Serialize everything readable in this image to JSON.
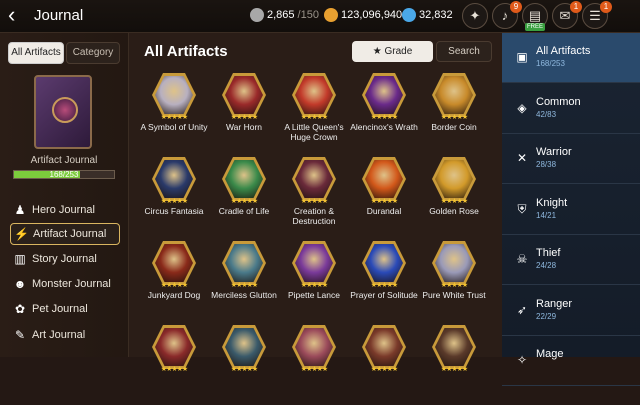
{
  "header": {
    "title": "Journal",
    "stamina": "2,865",
    "stamina_max": "/150",
    "gold": "123,096,940",
    "crystals": "32,832",
    "badges": {
      "bell": "9",
      "mail": "1",
      "grid": "1"
    },
    "free_label": "FREE",
    "icons": [
      "back-icon",
      "stamina-icon",
      "gold-icon",
      "crystal-icon",
      "event-icon",
      "bell-icon",
      "shop-icon",
      "mail-icon",
      "menu-icon"
    ]
  },
  "left": {
    "tabs": [
      "All Artifacts",
      "Category"
    ],
    "journal_label": "Artifact Journal",
    "progress_text": "168/253",
    "progress_fraction": 0.664,
    "nav": [
      {
        "label": "Hero Journal",
        "icon": "person-icon",
        "active": false
      },
      {
        "label": "Artifact Journal",
        "icon": "lightning-icon",
        "active": true
      },
      {
        "label": "Story Journal",
        "icon": "book-icon",
        "active": false
      },
      {
        "label": "Monster Journal",
        "icon": "monster-icon",
        "active": false
      },
      {
        "label": "Pet Journal",
        "icon": "paw-icon",
        "active": false
      },
      {
        "label": "Art Journal",
        "icon": "palette-icon",
        "active": false
      }
    ]
  },
  "center": {
    "title": "All Artifacts",
    "grade_label": "★ Grade",
    "search_label": "Search",
    "stars": "★★★★★",
    "artifacts": [
      {
        "name": "A Symbol of Unity",
        "color": "#b8b0c0"
      },
      {
        "name": "War Horn",
        "color": "#9a2a2a"
      },
      {
        "name": "A Little Queen's Huge Crown",
        "color": "#c23a2a"
      },
      {
        "name": "Alencinox's Wrath",
        "color": "#6a2a8a"
      },
      {
        "name": "Border Coin",
        "color": "#c88a2a"
      },
      {
        "name": "Circus Fantasia",
        "color": "#2a3a6a"
      },
      {
        "name": "Cradle of Life",
        "color": "#3a8a4a"
      },
      {
        "name": "Creation & Destruction",
        "color": "#6a2a3a"
      },
      {
        "name": "Durandal",
        "color": "#d2581a"
      },
      {
        "name": "Golden Rose",
        "color": "#d29a2a"
      },
      {
        "name": "Junkyard Dog",
        "color": "#8a2a1a"
      },
      {
        "name": "Merciless Glutton",
        "color": "#4a7a8a"
      },
      {
        "name": "Pipette Lance",
        "color": "#7a3a9a"
      },
      {
        "name": "Prayer of Solitude",
        "color": "#2a4ab8"
      },
      {
        "name": "Pure White Trust",
        "color": "#9a9ab8"
      },
      {
        "name": "",
        "color": "#8a2a2a"
      },
      {
        "name": "",
        "color": "#3a5a6a"
      },
      {
        "name": "",
        "color": "#9a4a5a"
      },
      {
        "name": "",
        "color": "#7a3a2a"
      },
      {
        "name": "",
        "color": "#5a3a2a"
      }
    ]
  },
  "right": {
    "categories": [
      {
        "label": "All Artifacts",
        "count": "168/253",
        "active": true,
        "icon": "all-icon"
      },
      {
        "label": "Common",
        "count": "42/83",
        "active": false,
        "icon": "common-icon"
      },
      {
        "label": "Warrior",
        "count": "28/38",
        "active": false,
        "icon": "warrior-icon"
      },
      {
        "label": "Knight",
        "count": "14/21",
        "active": false,
        "icon": "knight-icon"
      },
      {
        "label": "Thief",
        "count": "24/28",
        "active": false,
        "icon": "thief-icon"
      },
      {
        "label": "Ranger",
        "count": "22/29",
        "active": false,
        "icon": "ranger-icon"
      },
      {
        "label": "Mage",
        "count": "",
        "active": false,
        "icon": "mage-icon"
      }
    ]
  }
}
